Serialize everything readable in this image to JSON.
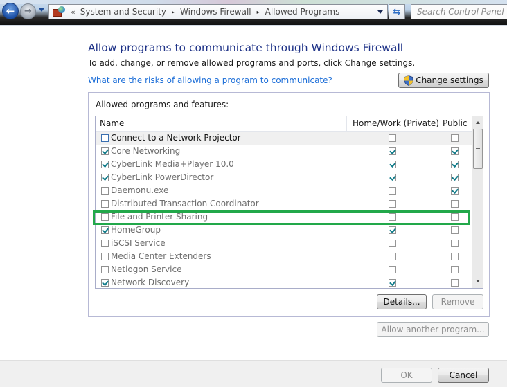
{
  "addressbar": {
    "overflow_chevron": "«",
    "breadcrumbs": [
      "System and Security",
      "Windows Firewall",
      "Allowed Programs"
    ],
    "separator": "▸",
    "search_placeholder": "Search Control Panel",
    "back_glyph": "←",
    "forward_glyph": "→",
    "refresh_glyph": "⇆"
  },
  "page": {
    "title": "Allow programs to communicate through Windows Firewall",
    "subtitle": "To add, change, or remove allowed programs and ports, click Change settings.",
    "risk_link": "What are the risks of allowing a program to communicate?",
    "change_settings_label": "Change settings"
  },
  "group": {
    "label": "Allowed programs and features:",
    "columns": {
      "name": "Name",
      "home": "Home/Work (Private)",
      "public": "Public"
    },
    "rows": [
      {
        "name": "Connect to a Network Projector",
        "enabled": false,
        "home": false,
        "public": false,
        "selected": true
      },
      {
        "name": "Core Networking",
        "enabled": true,
        "home": true,
        "public": true,
        "selected": false
      },
      {
        "name": "CyberLink Media+Player 10.0",
        "enabled": true,
        "home": true,
        "public": true,
        "selected": false
      },
      {
        "name": "CyberLink PowerDirector",
        "enabled": true,
        "home": true,
        "public": true,
        "selected": false
      },
      {
        "name": "Daemonu.exe",
        "enabled": false,
        "home": false,
        "public": true,
        "selected": false
      },
      {
        "name": "Distributed Transaction Coordinator",
        "enabled": false,
        "home": false,
        "public": false,
        "selected": false
      },
      {
        "name": "File and Printer Sharing",
        "enabled": false,
        "home": false,
        "public": false,
        "selected": false,
        "highlighted": true
      },
      {
        "name": "HomeGroup",
        "enabled": true,
        "home": true,
        "public": false,
        "selected": false
      },
      {
        "name": "iSCSI Service",
        "enabled": false,
        "home": false,
        "public": false,
        "selected": false
      },
      {
        "name": "Media Center Extenders",
        "enabled": false,
        "home": false,
        "public": false,
        "selected": false
      },
      {
        "name": "Netlogon Service",
        "enabled": false,
        "home": false,
        "public": false,
        "selected": false
      },
      {
        "name": "Network Discovery",
        "enabled": true,
        "home": true,
        "public": false,
        "selected": false
      }
    ],
    "details_label": "Details...",
    "remove_label": "Remove",
    "highlight_color": "#22a84a"
  },
  "allow_another_label": "Allow another program...",
  "footer": {
    "ok_label": "OK",
    "cancel_label": "Cancel"
  },
  "colors": {
    "title": "#1e3287",
    "link": "#1c6ed8",
    "check": "#127c8a"
  }
}
